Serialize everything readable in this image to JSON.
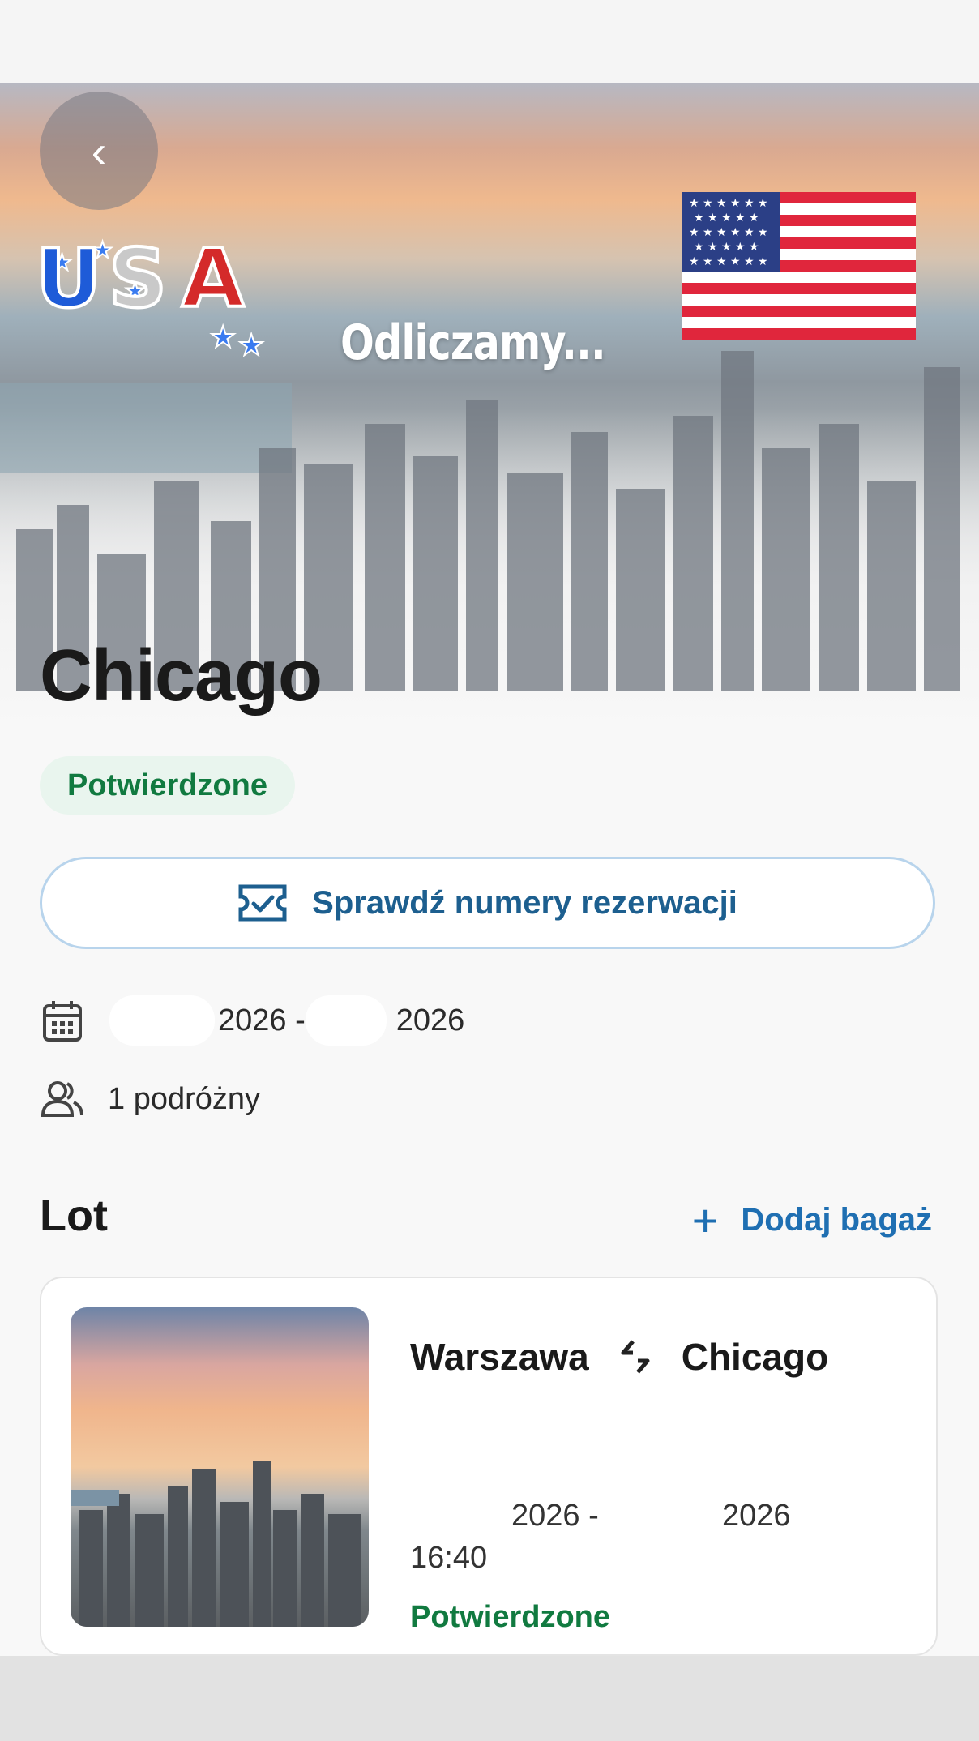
{
  "hero": {
    "countdown_text": "Odliczamy...",
    "back_icon": "chevron-left-icon",
    "usa_sticker_text": "USA",
    "flag": "us-flag"
  },
  "trip": {
    "title": "Chicago",
    "status": "Potwierdzone",
    "reservation_button_label": "Sprawdź numery rezerwacji",
    "reservation_icon": "ticket-check-icon",
    "date_start": "2026 -",
    "date_end": "2026",
    "date_icon": "calendar-icon",
    "travelers": "1 podróżny",
    "travelers_icon": "users-icon"
  },
  "flight_section": {
    "title": "Lot",
    "add_luggage_label": "Dodaj bagaż",
    "add_icon": "plus-icon"
  },
  "flight": {
    "from": "Warszawa",
    "to": "Chicago",
    "route_icon": "swap-arrows-icon",
    "date_start": "2026 -",
    "date_end": "2026",
    "time": "16:40",
    "status": "Potwierdzone"
  },
  "colors": {
    "confirmed_green": "#117a40",
    "accent_blue": "#1f6fb2",
    "badge_bg": "#e9f5ee"
  }
}
